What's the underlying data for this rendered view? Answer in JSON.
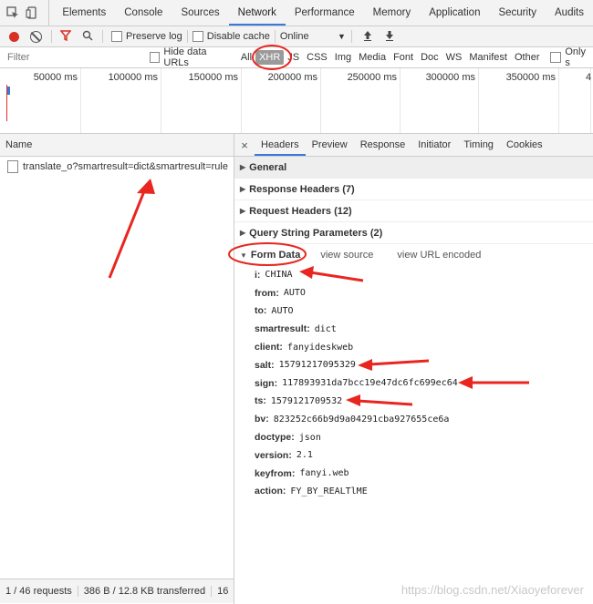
{
  "devtools_tabs": [
    "Elements",
    "Console",
    "Sources",
    "Network",
    "Performance",
    "Memory",
    "Application",
    "Security",
    "Audits"
  ],
  "active_tab": "Network",
  "toolbar": {
    "preserve_log": "Preserve log",
    "disable_cache": "Disable cache",
    "throttle": "Online"
  },
  "filterbar": {
    "placeholder": "Filter",
    "hide_data_urls": "Hide data URLs",
    "types": [
      "All",
      "XHR",
      "JS",
      "CSS",
      "Img",
      "Media",
      "Font",
      "Doc",
      "WS",
      "Manifest",
      "Other"
    ],
    "selected_type": "XHR",
    "only_label": "Only s"
  },
  "timeline": {
    "ticks": [
      "50000 ms",
      "100000 ms",
      "150000 ms",
      "200000 ms",
      "250000 ms",
      "300000 ms",
      "350000 ms",
      "4"
    ]
  },
  "requests": {
    "column_name": "Name",
    "items": [
      "translate_o?smartresult=dict&smartresult=rule"
    ]
  },
  "status": {
    "requests": "1 / 46 requests",
    "transferred": "386 B / 12.8 KB transferred",
    "extra": "16"
  },
  "detail_tabs": [
    "Headers",
    "Preview",
    "Response",
    "Initiator",
    "Timing",
    "Cookies"
  ],
  "active_detail_tab": "Headers",
  "sections": [
    "General",
    "Response Headers (7)",
    "Request Headers (12)",
    "Query String Parameters (2)"
  ],
  "form_data": {
    "title": "Form Data",
    "view_source": "view source",
    "view_url_encoded": "view URL encoded",
    "fields": [
      {
        "key": "i:",
        "value": "CHINA"
      },
      {
        "key": "from:",
        "value": "AUTO"
      },
      {
        "key": "to:",
        "value": "AUTO"
      },
      {
        "key": "smartresult:",
        "value": "dict"
      },
      {
        "key": "client:",
        "value": "fanyideskweb"
      },
      {
        "key": "salt:",
        "value": "15791217095329"
      },
      {
        "key": "sign:",
        "value": "117893931da7bcc19e47dc6fc699ec64"
      },
      {
        "key": "ts:",
        "value": "1579121709532"
      },
      {
        "key": "bv:",
        "value": "823252c66b9d9a04291cba927655ce6a"
      },
      {
        "key": "doctype:",
        "value": "json"
      },
      {
        "key": "version:",
        "value": "2.1"
      },
      {
        "key": "keyfrom:",
        "value": "fanyi.web"
      },
      {
        "key": "action:",
        "value": "FY_BY_REALTlME"
      }
    ]
  },
  "watermark": "https://blog.csdn.net/Xiaoyeforever",
  "colors": {
    "accent": "#3879d9",
    "record": "#d93025",
    "annotation": "#e8261f"
  }
}
